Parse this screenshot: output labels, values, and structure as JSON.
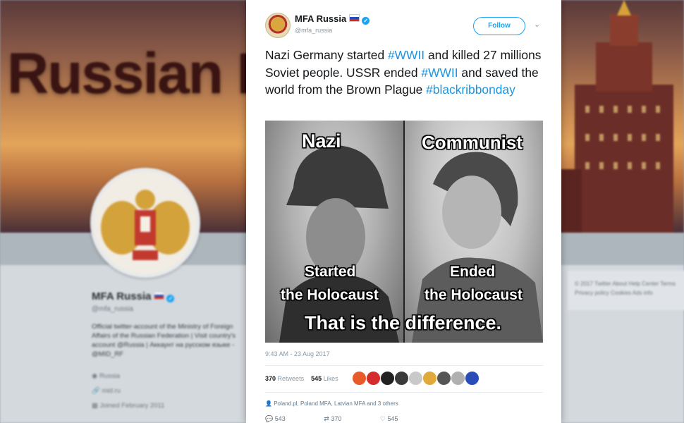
{
  "background_profile": {
    "banner_title": "Russian Fo",
    "name": "MFA Russia",
    "handle": "@mfa_russia",
    "bio": "Official twitter-account of the Ministry of Foreign Affairs of the Russian Federation | Visit country's account @Russia | Аккаунт на русском языке - @MID_RF",
    "location": "Russia",
    "website": "mid.ru",
    "joined": "Joined February 2011",
    "footer": "© 2017 Twitter   About   Help Center   Terms   Privacy policy   Cookies   Ads info"
  },
  "tweet": {
    "display_name": "MFA Russia",
    "handle": "@mfa_russia",
    "follow_label": "Follow",
    "text_parts": [
      "Nazi Germany started ",
      "#WWII",
      " and killed 27 millions Soviet people. USSR ended ",
      "#WWII",
      " and saved the world from the Brown Plague ",
      "#blackribbonday"
    ],
    "image": {
      "left_caption_top": "Nazi",
      "right_caption_top": "Communist",
      "left_caption_bottom_1": "Started",
      "left_caption_bottom_2": "the Holocaust",
      "right_caption_bottom_1": "Ended",
      "right_caption_bottom_2": "the Holocaust",
      "bottom_caption": "That is the difference."
    },
    "timestamp": "9:43 AM - 23 Aug 2017",
    "retweets_count": "370",
    "retweets_label": "Retweets",
    "likes_count": "545",
    "likes_label": "Likes",
    "liked_by": "Poland.pl, Poland MFA, Latvian MFA and 3 others",
    "reply_count": "543",
    "retweet_action_count": "370",
    "like_action_count": "545"
  },
  "colors": {
    "link": "#1b95e0",
    "follow": "#1da1f2",
    "verified": "#1da1f2"
  }
}
